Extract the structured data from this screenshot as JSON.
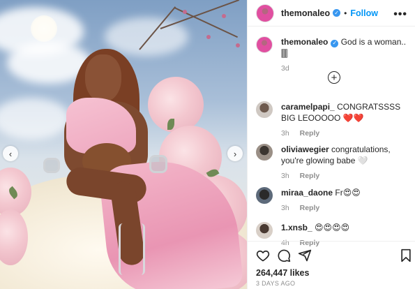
{
  "post": {
    "username": "themonaleo",
    "verified_icon": "verified-badge-icon",
    "follow_label": "Follow",
    "more_icon": "more-options-icon",
    "more_glyph": "•••",
    "nav_prev_glyph": "‹",
    "nav_next_glyph": "›"
  },
  "caption": {
    "username": "themonaleo",
    "text": "God is a woman.. 🀫",
    "age": "3d"
  },
  "load_more_glyph": "+",
  "comments": [
    {
      "username": "caramelpapi_",
      "text": "CONGRATSSSS BIG LEOOOOO ❤️❤️",
      "age": "3h",
      "reply_label": "Reply"
    },
    {
      "username": "oliviawegier",
      "text": "congratulations, you're glowing babe 🤍",
      "age": "3h",
      "reply_label": "Reply"
    },
    {
      "username": "miraa_daone",
      "text": "Fr😍😍",
      "age": "3h",
      "reply_label": "Reply"
    },
    {
      "username": "1.xnsb_",
      "text": "😍😍😍😍",
      "age": "4h",
      "reply_label": "Reply"
    }
  ],
  "footer": {
    "likes": "264,447 likes",
    "date": "3 DAYS AGO"
  },
  "colors": {
    "accent": "#0095f6",
    "verified": "#3897f0",
    "heart": "#ed4956"
  }
}
